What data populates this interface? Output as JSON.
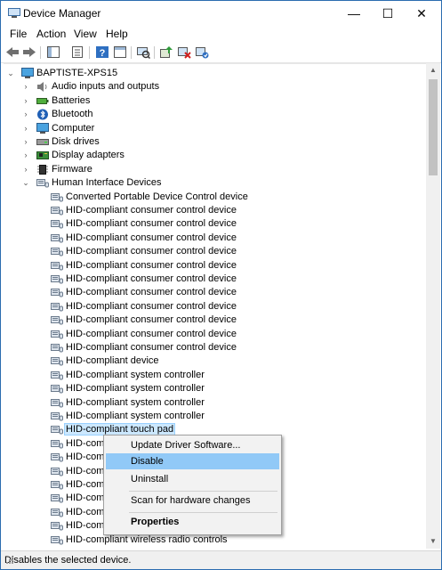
{
  "window": {
    "title": "Device Manager",
    "minimize": "—",
    "maximize": "☐",
    "close": "✕"
  },
  "menu": [
    "File",
    "Action",
    "View",
    "Help"
  ],
  "toolbar_icons": [
    "back-icon",
    "forward-icon",
    "show-hide-console-tree-icon",
    "properties-icon",
    "help-icon",
    "console-icon",
    "scan-hardware-icon",
    "uninstall-icon",
    "update-driver-icon"
  ],
  "tree": {
    "root": "BAPTISTE-XPS15",
    "categories": [
      {
        "label": "Audio inputs and outputs",
        "icon": "speaker-icon"
      },
      {
        "label": "Batteries",
        "icon": "battery-icon"
      },
      {
        "label": "Bluetooth",
        "icon": "bluetooth-icon"
      },
      {
        "label": "Computer",
        "icon": "computer-icon"
      },
      {
        "label": "Disk drives",
        "icon": "disk-icon"
      },
      {
        "label": "Display adapters",
        "icon": "display-adapter-icon"
      },
      {
        "label": "Firmware",
        "icon": "firmware-icon"
      }
    ],
    "expanded": {
      "label": "Human Interface Devices",
      "icon": "hid-icon"
    },
    "children": [
      "Converted Portable Device Control device",
      "HID-compliant consumer control device",
      "HID-compliant consumer control device",
      "HID-compliant consumer control device",
      "HID-compliant consumer control device",
      "HID-compliant consumer control device",
      "HID-compliant consumer control device",
      "HID-compliant consumer control device",
      "HID-compliant consumer control device",
      "HID-compliant consumer control device",
      "HID-compliant consumer control device",
      "HID-compliant consumer control device",
      "HID-compliant device",
      "HID-compliant system controller",
      "HID-compliant system controller",
      "HID-compliant system controller",
      "HID-compliant system controller",
      "HID-compliant touch pad",
      "HID-com",
      "HID-com",
      "HID-com",
      "HID-com",
      "HID-com",
      "HID-com",
      "HID-com",
      "HID-compliant wireless radio controls"
    ],
    "selected_index": 17
  },
  "context_menu": {
    "items": [
      {
        "label": "Update Driver Software...",
        "highlighted": false,
        "bold": false
      },
      {
        "label": "Disable",
        "highlighted": true,
        "bold": false
      },
      {
        "label": "Uninstall",
        "highlighted": false,
        "bold": false
      },
      {
        "label": "Scan for hardware changes",
        "highlighted": false,
        "bold": false
      },
      {
        "label": "Properties",
        "highlighted": false,
        "bold": true
      }
    ]
  },
  "status": "Disables the selected device.",
  "colors": {
    "accent": "#2b6cb0",
    "selection": "#cce8ff",
    "menu_highlight": "#91c9f7"
  }
}
